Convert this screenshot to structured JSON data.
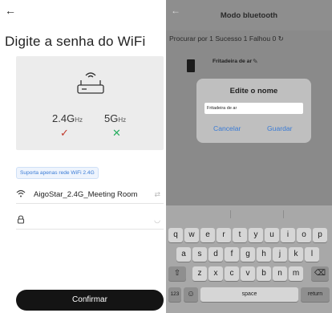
{
  "left": {
    "back_icon": "arrow-left-icon",
    "title": "Digite a senha do WiFi",
    "band_24": "2.4G",
    "band_24_unit": "Hz",
    "band_5": "5G",
    "band_5_unit": "Hz",
    "band_24_mark": "✓",
    "band_5_mark": "✕",
    "wifi_note": "Suporta apenas rede WiFi 2.4G",
    "ssid": "AigoStar_2.4G_Meeting Room",
    "password_value": "",
    "confirm_label": "Confirmar"
  },
  "right": {
    "title": "Modo bluetooth",
    "status": "Procurar por 1  Sucesso 1  Falhou 0  ↻",
    "device_name": "Fritadeira de ar",
    "dialog_title": "Edite o nome",
    "dialog_value": "Fritadeira de ar",
    "cancel_label": "Cancelar",
    "save_label": "Guardar"
  },
  "keyboard": {
    "row1": [
      "q",
      "w",
      "e",
      "r",
      "t",
      "y",
      "u",
      "i",
      "o",
      "p"
    ],
    "row2": [
      "a",
      "s",
      "d",
      "f",
      "g",
      "h",
      "j",
      "k",
      "l"
    ],
    "row3": [
      "z",
      "x",
      "c",
      "v",
      "b",
      "n",
      "m"
    ],
    "shift": "⇧",
    "backspace": "⌫",
    "num": "123",
    "emoji": "☺",
    "space": "space",
    "return": "return"
  },
  "colors": {
    "accent": "#3a7bd5",
    "check": "#c0392b",
    "cross": "#27ae60",
    "confirm_bg": "#141414"
  }
}
